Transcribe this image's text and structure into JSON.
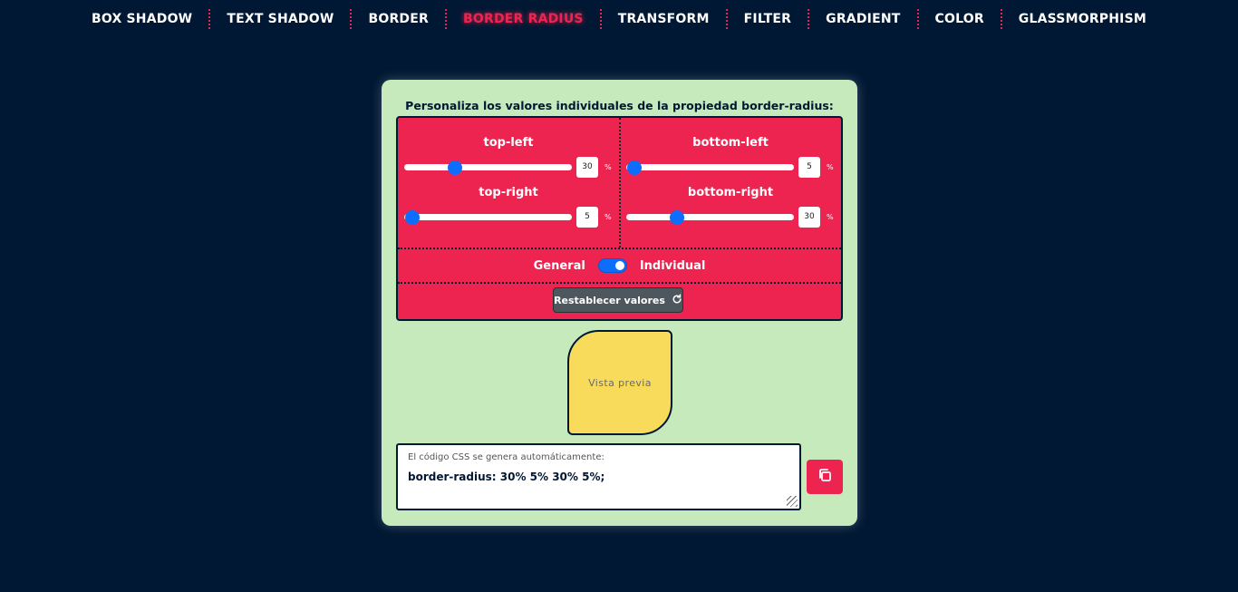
{
  "nav": {
    "items": [
      {
        "label": "BOX SHADOW"
      },
      {
        "label": "TEXT SHADOW"
      },
      {
        "label": "BORDER"
      },
      {
        "label": "BORDER RADIUS",
        "active": true
      },
      {
        "label": "TRANSFORM"
      },
      {
        "label": "FILTER"
      },
      {
        "label": "GRADIENT"
      },
      {
        "label": "COLOR"
      },
      {
        "label": "GLASSMORPHISM"
      }
    ]
  },
  "card": {
    "title": "Personaliza los valores individuales de la propiedad border-radius:"
  },
  "sliders": {
    "top_left": {
      "label": "top-left",
      "value": "30",
      "unit": "%",
      "fraction": 0.3
    },
    "bottom_left": {
      "label": "bottom-left",
      "value": "5",
      "unit": "%",
      "fraction": 0.05
    },
    "top_right": {
      "label": "top-right",
      "value": "5",
      "unit": "%",
      "fraction": 0.05
    },
    "bottom_right": {
      "label": "bottom-right",
      "value": "30",
      "unit": "%",
      "fraction": 0.3
    }
  },
  "mode_toggle": {
    "left_label": "General",
    "right_label": "Individual",
    "on": true
  },
  "reset_button": {
    "label": "Restablecer valores",
    "icon": "refresh-icon"
  },
  "preview": {
    "label": "Vista previa"
  },
  "output": {
    "label": "El código CSS se genera automáticamente:",
    "code": "border-radius: 30% 5% 30% 5%;"
  },
  "copy_button": {
    "icon": "copy-icon"
  },
  "colors": {
    "background": "#001833",
    "accent": "#ee2450",
    "card": "#c6eabc",
    "preview": "#f9db5b",
    "slider_thumb": "#0d6efd"
  }
}
